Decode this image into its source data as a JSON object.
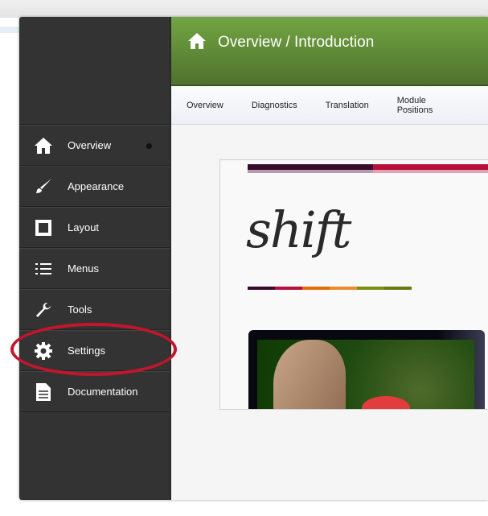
{
  "header": {
    "title": "Overview / Introduction",
    "icon": "home-icon"
  },
  "tabs": [
    {
      "label": "Overview"
    },
    {
      "label": "Diagnostics"
    },
    {
      "label": "Translation"
    },
    {
      "label": "Module Positions"
    }
  ],
  "sidebar": {
    "items": [
      {
        "label": "Overview",
        "icon": "home-icon",
        "active": true
      },
      {
        "label": "Appearance",
        "icon": "paintbrush-icon"
      },
      {
        "label": "Layout",
        "icon": "layout-icon"
      },
      {
        "label": "Menus",
        "icon": "list-icon"
      },
      {
        "label": "Tools",
        "icon": "wrench-icon"
      },
      {
        "label": "Settings",
        "icon": "gear-icon",
        "highlighted": true
      },
      {
        "label": "Documentation",
        "icon": "document-icon"
      }
    ]
  },
  "content": {
    "logo": "shift",
    "brand_colors": [
      "#3a0a2c",
      "#b5103c",
      "#e36c0a",
      "#ec8a2d",
      "#7b8f0c",
      "#6a7a10"
    ],
    "highlight_color": "#c3152b"
  }
}
